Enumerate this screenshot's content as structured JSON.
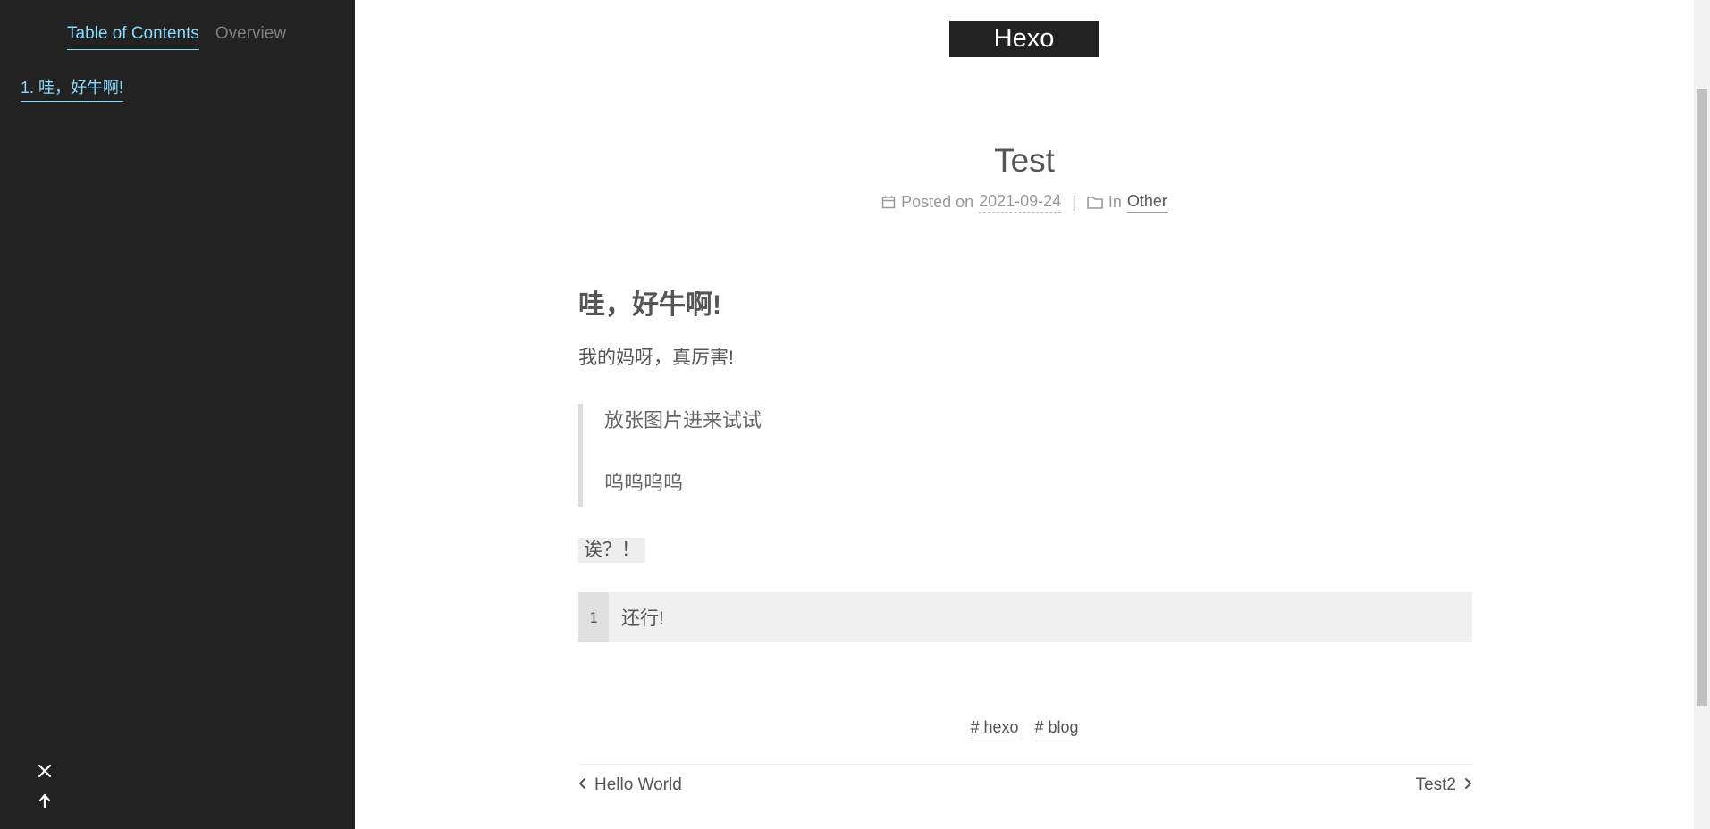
{
  "sidebar": {
    "tabs": [
      {
        "label": "Table of Contents",
        "active": true
      },
      {
        "label": "Overview",
        "active": false
      }
    ],
    "toc": [
      {
        "label": "1. 哇，好牛啊!"
      }
    ],
    "controls": {
      "close_icon": "close-icon",
      "back_to_top_icon": "arrow-up-icon"
    }
  },
  "header": {
    "brand": "Hexo"
  },
  "post": {
    "title": "Test",
    "meta": {
      "posted_label": "Posted on",
      "date": "2021-09-24",
      "separator": "|",
      "in_label": "In",
      "category": "Other"
    },
    "heading": "哇，好牛啊!",
    "paragraph": "我的妈呀，真厉害!",
    "quote": [
      "放张图片进来试试",
      "呜呜呜呜"
    ],
    "inline_code": "诶？！",
    "code": {
      "line_number": "1",
      "text": "还行!"
    },
    "tags": [
      "# hexo",
      "# blog"
    ],
    "nav": {
      "prev": "Hello World",
      "next": "Test2"
    }
  },
  "colors": {
    "sidebar_bg": "#222222",
    "accent": "#87daff",
    "text": "#555555",
    "meta": "#999999"
  }
}
